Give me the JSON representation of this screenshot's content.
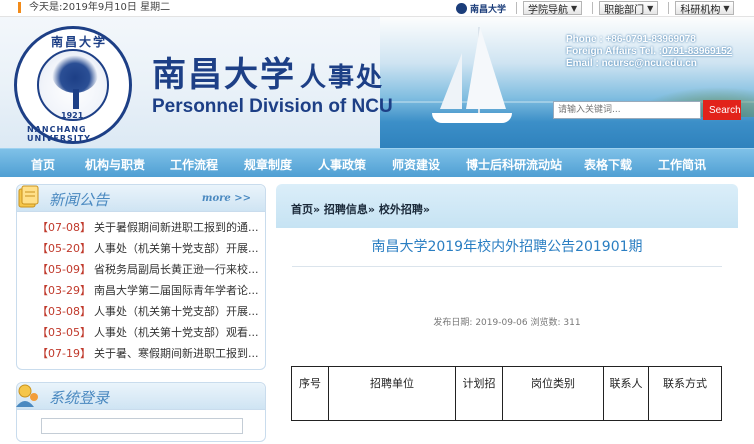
{
  "topbar": {
    "today": "今天是:2019年9月10日 星期二",
    "logo_text": "南昌大学",
    "quick_links": [
      {
        "label": "学院导航"
      },
      {
        "label": "职能部门"
      },
      {
        "label": "科研机构"
      }
    ]
  },
  "header": {
    "seal": {
      "top_text": "南昌大学",
      "bottom_text": "NANCHANG UNIVERSITY",
      "year": "1921"
    },
    "title_cn": "南昌大学",
    "title_cn_sub": "人事处",
    "title_en": "Personnel Division of NCU",
    "phone": "Phone : +86-0791-83969078",
    "fax_label": "Foreign Affairs Tel. :",
    "fax": "0791-83969152",
    "email": "Email : ncursc@ncu.edu.cn",
    "search_placeholder": "请输入关键词...",
    "search_button": "Search"
  },
  "nav": [
    "首页",
    "机构与职责",
    "工作流程",
    "规章制度",
    "人事政策",
    "师资建设",
    "博士后科研流动站",
    "表格下载",
    "工作简讯"
  ],
  "news": {
    "title": "新闻公告",
    "more": "more >>",
    "items": [
      {
        "date": "【07-08】",
        "text": "关于暑假期间新进职工报到的通..."
      },
      {
        "date": "【05-20】",
        "text": "人事处（机关第十党支部）开展..."
      },
      {
        "date": "【05-09】",
        "text": "省税务局副局长黄正逊一行来校..."
      },
      {
        "date": "【03-29】",
        "text": "南昌大学第二届国际青年学者论..."
      },
      {
        "date": "【03-08】",
        "text": "人事处（机关第十党支部）开展..."
      },
      {
        "date": "【03-05】",
        "text": "人事处（机关第十党支部）观看..."
      },
      {
        "date": "【07-19】",
        "text": "关于暑、寒假期间新进职工报到..."
      }
    ]
  },
  "login": {
    "title": "系统登录"
  },
  "content": {
    "breadcrumb": "首页» 招聘信息» 校外招聘»",
    "title": "南昌大学2019年校内外招聘公告201901期",
    "meta": "发布日期: 2019-09-06 浏览数: 311",
    "table_headers": [
      "序号",
      "招聘单位",
      "计划招",
      "岗位类别",
      "联系人",
      "联系方式"
    ]
  },
  "colors": {
    "brand_blue": "#1d3f86",
    "nav_blue": "#5aa7d8",
    "accent_red": "#e2231a",
    "link_blue": "#2a7ec2"
  }
}
